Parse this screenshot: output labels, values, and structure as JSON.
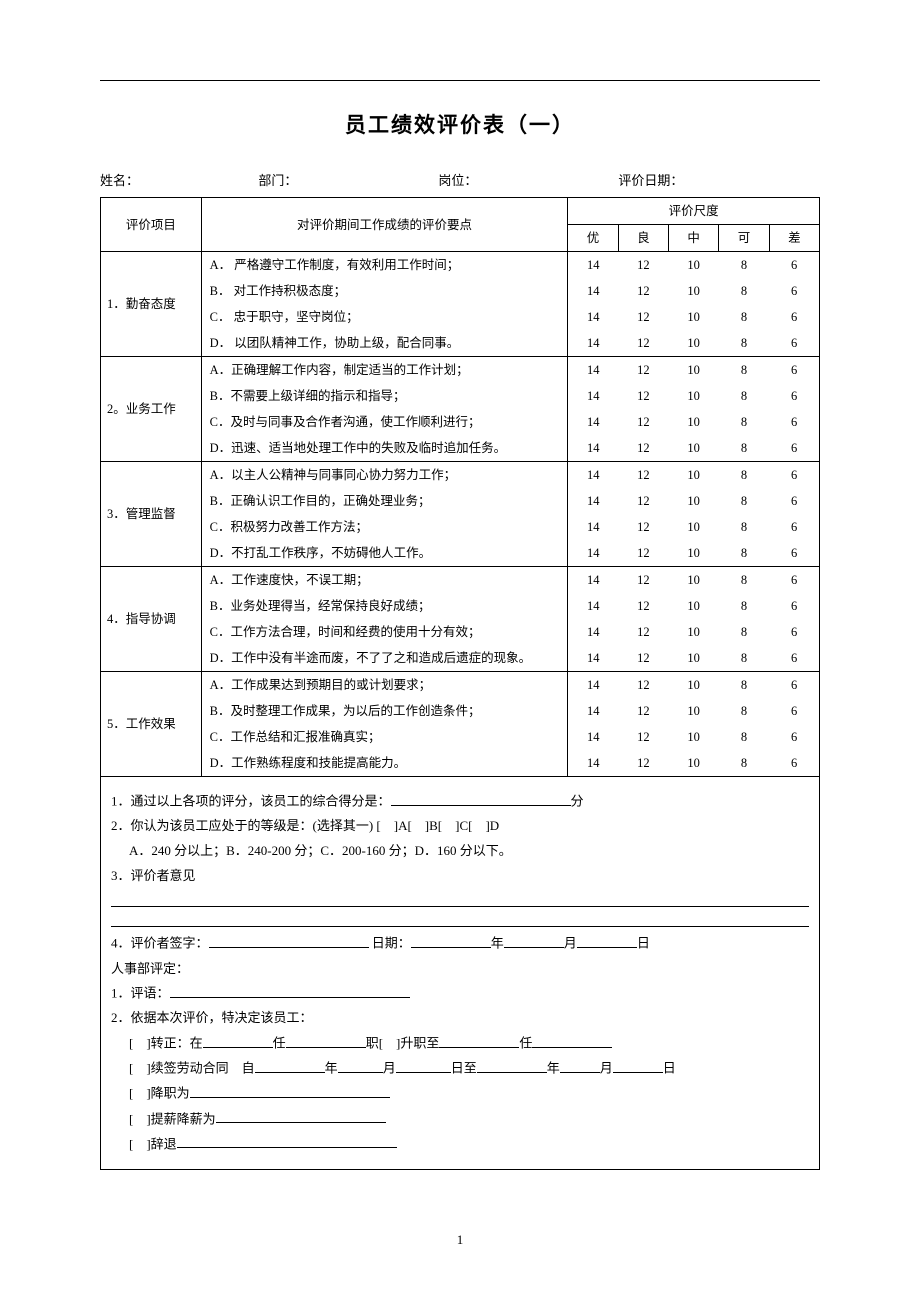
{
  "title": "员工绩效评价表（一）",
  "meta": {
    "name_label": "姓名：",
    "dept_label": "部门：",
    "post_label": "岗位：",
    "date_label": "评价日期："
  },
  "header": {
    "col_project": "评价项目",
    "col_points": "对评价期间工作成绩的评价要点",
    "col_scale": "评价尺度",
    "scale": [
      "优",
      "良",
      "中",
      "可",
      "差"
    ]
  },
  "score_values": [
    "14",
    "12",
    "10",
    "8",
    "6"
  ],
  "sections": [
    {
      "name": "1．勤奋态度",
      "items": [
        "A．   严格遵守工作制度，有效利用工作时间；",
        "B．   对工作持积极态度；",
        "C．   忠于职守，坚守岗位；",
        "D．   以团队精神工作，协助上级，配合同事。"
      ]
    },
    {
      "name": "2。业务工作",
      "items": [
        "A．正确理解工作内容，制定适当的工作计划；",
        "B．不需要上级详细的指示和指导；",
        "C．及时与同事及合作者沟通，使工作顺利进行；",
        "D．迅速、适当地处理工作中的失败及临时追加任务。"
      ]
    },
    {
      "name": "3．管理监督",
      "items": [
        "A．以主人公精神与同事同心协力努力工作；",
        "B．正确认识工作目的，正确处理业务；",
        "C．积极努力改善工作方法；",
        "D．不打乱工作秩序，不妨碍他人工作。"
      ]
    },
    {
      "name": "4．指导协调",
      "items": [
        "A．工作速度快，不误工期；",
        "B．业务处理得当，经常保持良好成绩；",
        "C．工作方法合理，时间和经费的使用十分有效；",
        "D．工作中没有半途而废，不了了之和造成后遗症的现象。"
      ]
    },
    {
      "name": "5．工作效果",
      "items": [
        "A．工作成果达到预期目的或计划要求；",
        "B．及时整理工作成果，为以后的工作创造条件；",
        "C．工作总结和汇报准确真实；",
        "D．工作熟练程度和技能提高能力。"
      ]
    }
  ],
  "notes": {
    "line1_a": "1．通过以上各项的评分，该员工的综合得分是：",
    "line1_b": "分",
    "line2": "2．你认为该员工应处于的等级是：(选择其一) [　]A[　]B[　]C[　]D",
    "line2_sub": "A．240 分以上；B．240-200 分；C．200-160 分；D．160 分以下。",
    "line3": "3．评价者意见",
    "line4_a": "4．评价者签字：",
    "line4_b": " 日期：",
    "line4_c": "年",
    "line4_d": "月",
    "line4_e": "日",
    "hr_title": "人事部评定：",
    "hr1": "1．评语：",
    "hr2": "2．依据本次评价，特决定该员工：",
    "opt1_a": "[　]转正：在",
    "opt1_b": "任",
    "opt1_c": "职[　]升职至",
    "opt1_d": "任",
    "opt2_a": "[　]续签劳动合同　自",
    "opt2_b": "年",
    "opt2_c": "月",
    "opt2_d": "日至",
    "opt2_e": "年",
    "opt2_f": "月",
    "opt2_g": "日",
    "opt3": "[　]降职为",
    "opt4": "[　]提薪降薪为",
    "opt5": "[　]辞退"
  },
  "page_number": "1"
}
